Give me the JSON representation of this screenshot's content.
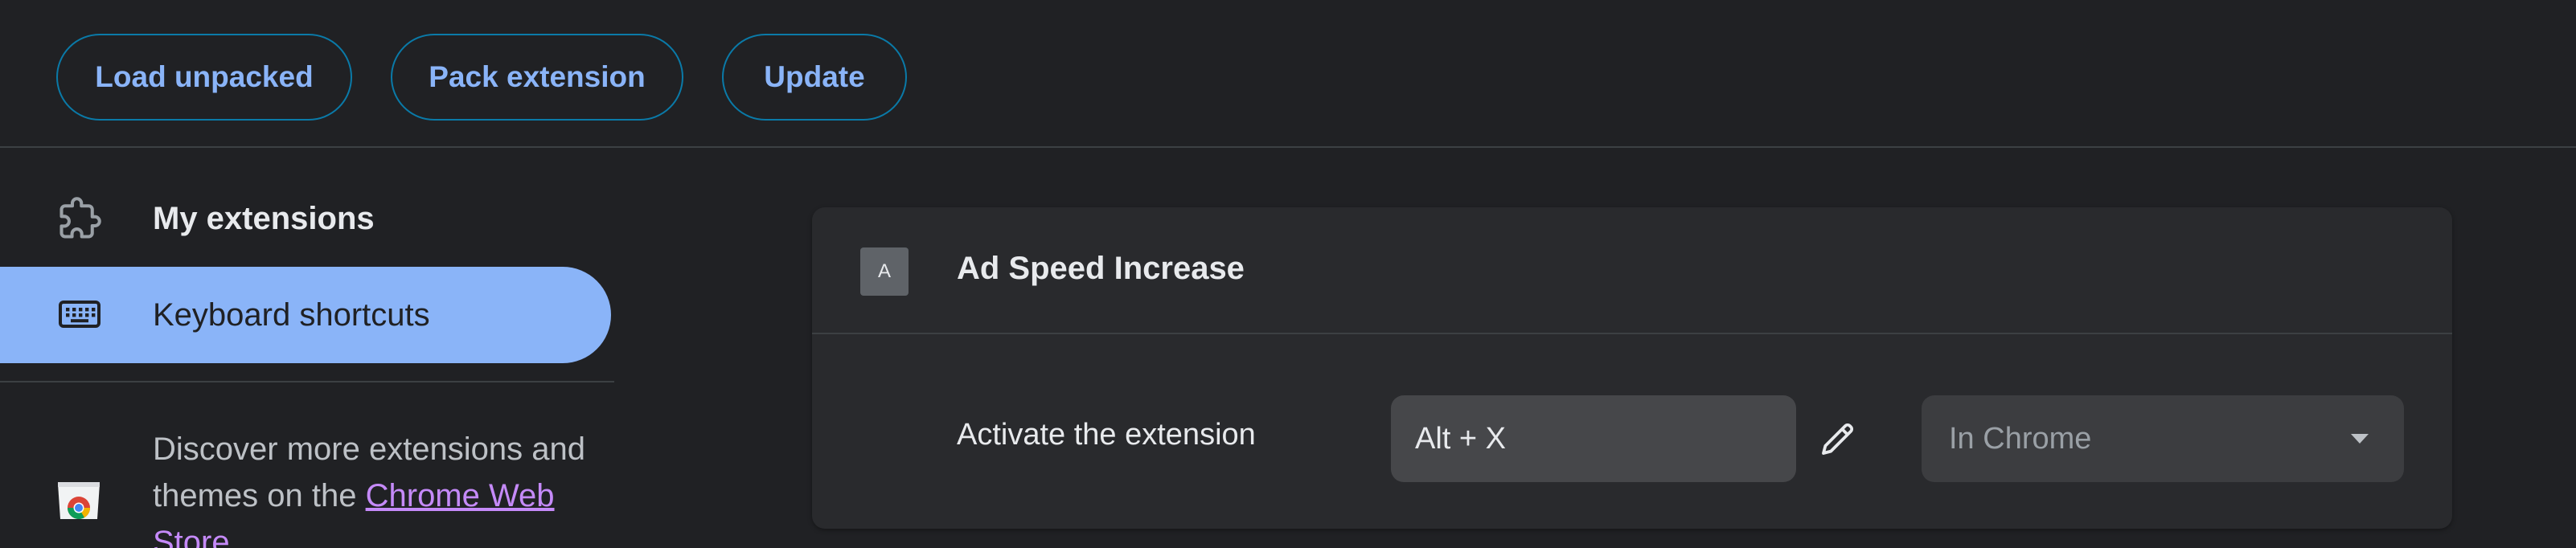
{
  "toolbar": {
    "load_unpacked": "Load unpacked",
    "pack_extension": "Pack extension",
    "update": "Update"
  },
  "sidebar": {
    "items": [
      {
        "label": "My extensions",
        "icon": "puzzle-piece-icon",
        "selected": false
      },
      {
        "label": "Keyboard shortcuts",
        "icon": "keyboard-icon",
        "selected": true
      }
    ],
    "discover": {
      "text_before": "Discover more extensions and themes on the ",
      "link_text": "Chrome Web Store",
      "icon": "chrome-web-store-icon"
    }
  },
  "extension": {
    "icon_letter": "A",
    "name": "Ad Speed Increase",
    "commands": [
      {
        "label": "Activate the extension",
        "shortcut": "Alt + X",
        "scope": "In Chrome",
        "edit_icon": "pencil-icon"
      }
    ]
  },
  "colors": {
    "background": "#202124",
    "card": "#292a2d",
    "accent": "#8ab4f8",
    "pill_border": "#0a7aa8",
    "link": "#c58af9",
    "divider": "#3c4043"
  }
}
